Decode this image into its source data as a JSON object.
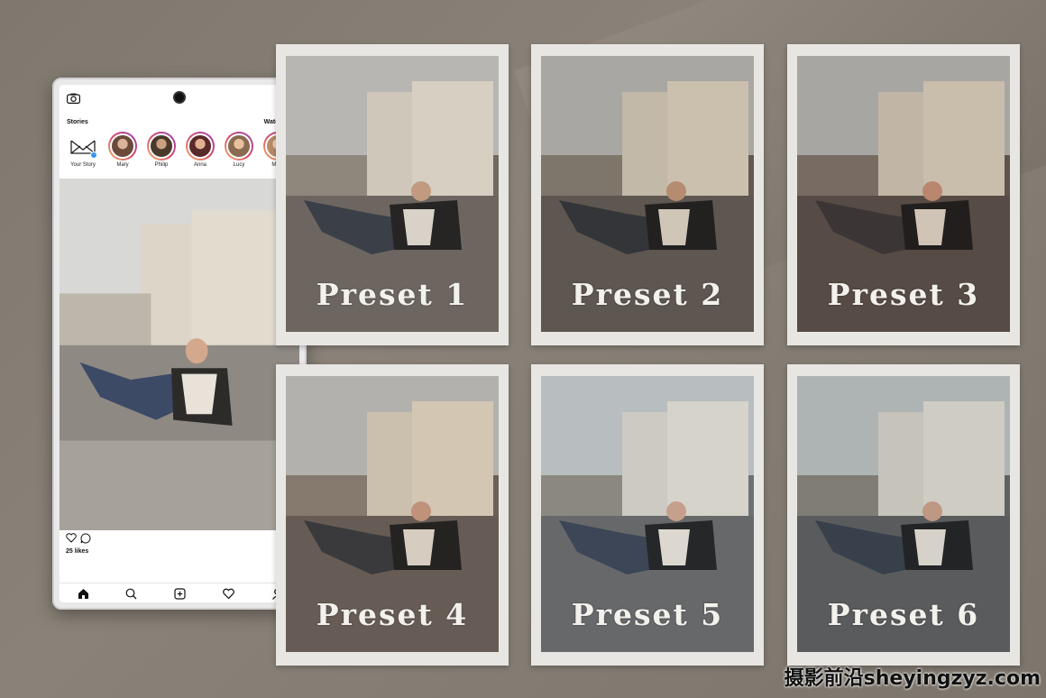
{
  "phone": {
    "stories_label": "Stories",
    "watch_all_label": "Watch All",
    "stories": [
      {
        "name": "Your Story",
        "icon": "monogram-logo-icon"
      },
      {
        "name": "Mary",
        "color": "#7a5a4a"
      },
      {
        "name": "Philip",
        "color": "#5a4a3a"
      },
      {
        "name": "Anna",
        "color": "#6a3a3a"
      },
      {
        "name": "Lucy",
        "color": "#8a6a5a"
      },
      {
        "name": "Mark",
        "color": "#b08a70"
      }
    ],
    "likes": "25 likes",
    "nav": [
      "home-icon",
      "search-icon",
      "add-post-icon",
      "activity-heart-icon",
      "profile-icon"
    ]
  },
  "presets": [
    {
      "label": "Preset 1",
      "tint": "#6f6a63"
    },
    {
      "label": "Preset 2",
      "tint": "#625a52"
    },
    {
      "label": "Preset 3",
      "tint": "#5e534d"
    },
    {
      "label": "Preset 4",
      "tint": "#6b615a"
    },
    {
      "label": "Preset 5",
      "tint": "#6c7273"
    },
    {
      "label": "Preset 6",
      "tint": "#5f6262"
    }
  ],
  "watermark": "摄影前沿sheyingzyz.com"
}
